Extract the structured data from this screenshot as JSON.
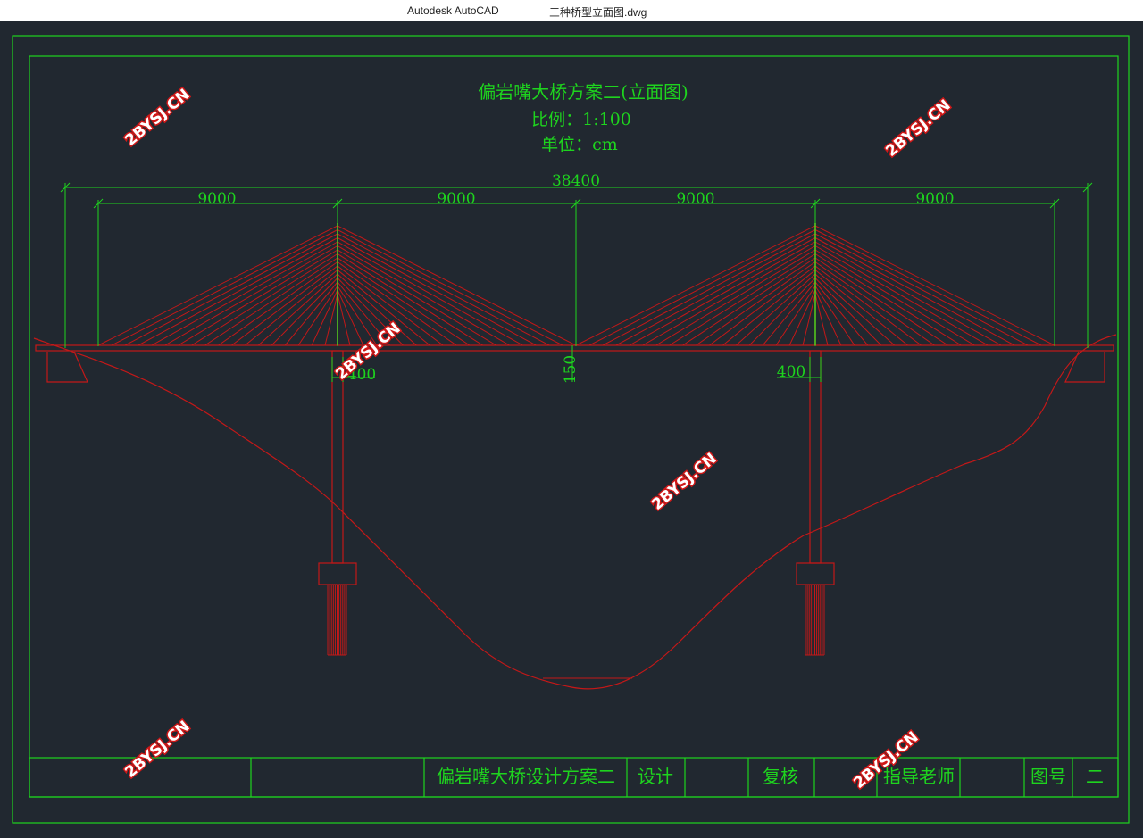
{
  "window": {
    "app_name": "Autodesk AutoCAD",
    "file_name": "三种桥型立面图.dwg"
  },
  "drawing": {
    "title": "偏岩嘴大桥方案二(立面图)",
    "scale": "比例：1:100",
    "unit": "单位：cm",
    "dimensions": {
      "total": "38400",
      "span1": "9000",
      "span2": "9000",
      "span3": "9000",
      "span4": "9000",
      "pier_left": "400",
      "pier_right": "400",
      "deck": "150"
    }
  },
  "title_block": {
    "project": "偏岩嘴大桥设计方案二",
    "design": "设计",
    "review": "复核",
    "advisor": "指导老师",
    "drawing_no_label": "图号",
    "drawing_no": "二"
  },
  "watermark": "2BYSJ.CN",
  "colors": {
    "background": "#212830",
    "frame": "#1ed41e",
    "structure": "#c41818",
    "text": "#1ed41e",
    "tower": "#c8c818"
  }
}
